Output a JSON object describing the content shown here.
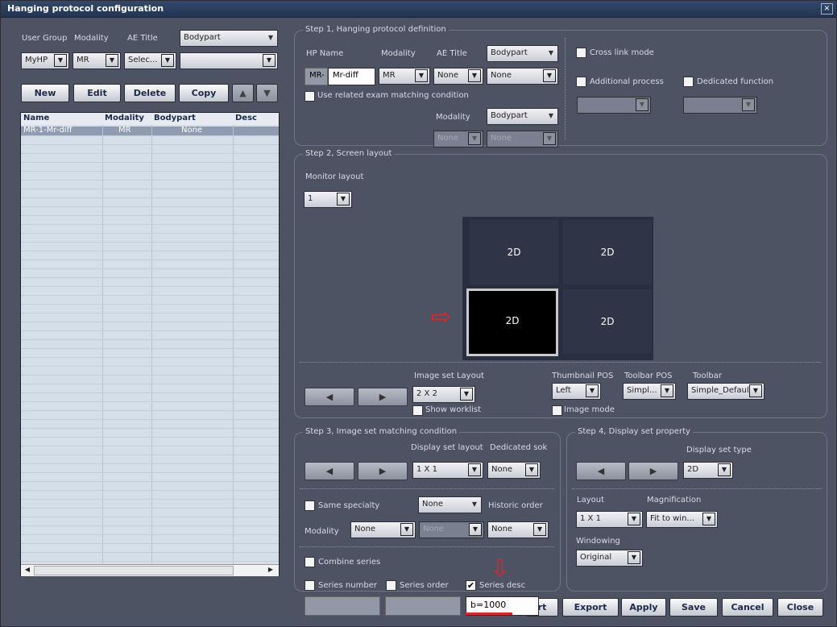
{
  "window": {
    "title": "Hanging protocol configuration",
    "close_glyph": "×"
  },
  "left": {
    "labels": {
      "user_group": "User Group",
      "modality": "Modality",
      "ae_title": "AE Title"
    },
    "bodypart_header": "Bodypart",
    "user_group_value": "MyHP",
    "modality_value": "MR",
    "ae_title_value": "Selec...",
    "bodypart_value": "",
    "buttons": {
      "new": "New",
      "edit": "Edit",
      "delete": "Delete",
      "copy": "Copy"
    },
    "table": {
      "columns": [
        "Name",
        "Modality",
        "Bodypart",
        "Desc"
      ],
      "rows": [
        {
          "name": "MR-1-Mr-diff",
          "modality": "MR",
          "bodypart": "None",
          "desc": ""
        }
      ]
    }
  },
  "step1": {
    "title": "Step 1, Hanging protocol definition",
    "hp_name_label": "HP Name",
    "modality_label": "Modality",
    "ae_title_label": "AE Title",
    "bodypart_label": "Bodypart",
    "hp_prefix": "MR-",
    "hp_name_value": "Mr-diff",
    "modality_value": "MR",
    "ae_title_value": "None",
    "bodypart_value": "None",
    "use_related_label": "Use related exam matching condition",
    "modality2_label": "Modality",
    "bodypart2_label": "Bodypart",
    "modality2_value": "None",
    "bodypart2_value": "None",
    "cross_link_label": "Cross link mode",
    "additional_process_label": "Additional process",
    "dedicated_function_label": "Dedicated function"
  },
  "step2": {
    "title": "Step 2, Screen layout",
    "monitor_layout_label": "Monitor layout",
    "monitor_layout_value": "1",
    "tiles": [
      "2D",
      "2D",
      "2D",
      "2D"
    ],
    "image_set_layout_label": "Image set Layout",
    "image_set_layout_value": "2 X 2",
    "show_worklist_label": "Show worklist",
    "thumbnail_pos_label": "Thumbnail POS",
    "thumbnail_pos_value": "Left",
    "toolbar_pos_label": "Toolbar POS",
    "toolbar_pos_value": "Simpl...",
    "toolbar_label": "Toolbar",
    "toolbar_value": "Simple_Default",
    "image_mode_label": "Image mode"
  },
  "step3": {
    "title": "Step 3, Image set matching condition",
    "display_set_layout_label": "Display set layout",
    "dedicated_sok_label": "Dedicated sok",
    "display_set_layout_value": "1 X 1",
    "dedicated_value": "None",
    "same_specialty_label": "Same specialty",
    "specialty_value": "None",
    "historic_order_label": "Historic order",
    "modality_label": "Modality",
    "modality_value": "None",
    "middle_value": "None",
    "historic_value": "None",
    "combine_series_label": "Combine series",
    "series_number_label": "Series number",
    "series_order_label": "Series order",
    "series_desc_label": "Series desc",
    "series_desc_value": "b=1000",
    "checkmark": "✔"
  },
  "step4": {
    "title": "Step 4, Display set property",
    "display_set_type_label": "Display set type",
    "display_set_type_value": "2D",
    "layout_label": "Layout",
    "magnification_label": "Magnification",
    "layout_value": "1 X 1",
    "magnification_value": "Fit to win...",
    "windowing_label": "Windowing",
    "windowing_value": "Original"
  },
  "bottom": {
    "import_partial": "rt",
    "export": "Export",
    "apply": "Apply",
    "save": "Save",
    "cancel": "Cancel",
    "close": "Close"
  },
  "glyphs": {
    "dd": "▼",
    "left": "◀",
    "right": "▶",
    "up": "▲",
    "down": "▼",
    "arrow_right": "⇨",
    "arrow_down": "⇩",
    "scroll_left": "◀",
    "scroll_right": "▶"
  },
  "colors": {
    "background": "#4e5363",
    "annotation_red": "#e0242a",
    "title_bar": "#2b405f"
  }
}
